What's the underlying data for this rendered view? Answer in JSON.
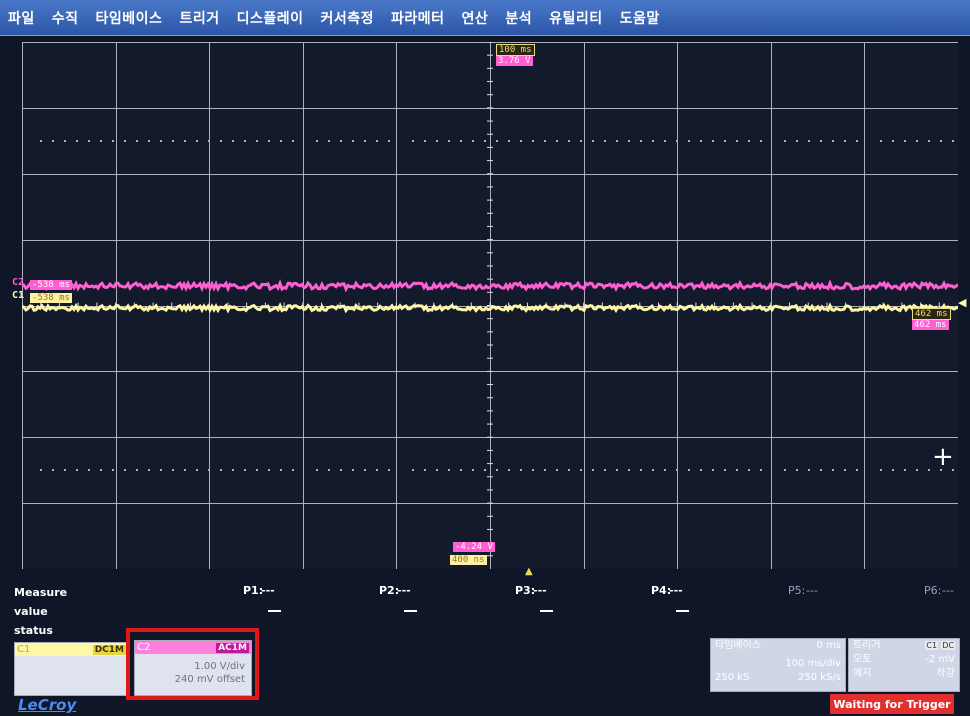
{
  "menu": [
    "파일",
    "수직",
    "타임베이스",
    "트리거",
    "디스플레이",
    "커서측정",
    "파라메터",
    "연산",
    "분석",
    "유틸리티",
    "도움말"
  ],
  "markers": {
    "top_time": "100 ms",
    "top_volt": "3.76 V",
    "bottom_volt": "-4.24 V",
    "bottom_time": "400 ns",
    "left_c2": "-538 ms",
    "left_c1": "-538 ms",
    "right_c1": "462 ms",
    "right_c2": "462 ms",
    "c2_tag": "C2",
    "c1_tag": "C1",
    "trigger_pos_glyph": "▲",
    "level_glyph": "◀",
    "crosshair_glyph": "+"
  },
  "measure": {
    "title": "Measure",
    "value_label": "value",
    "status_label": "status",
    "params": [
      {
        "name": "P1:",
        "value": "---",
        "dash": "—"
      },
      {
        "name": "P2:",
        "value": "---",
        "dash": "—"
      },
      {
        "name": "P3:",
        "value": "---",
        "dash": "—"
      },
      {
        "name": "P4:",
        "value": "---",
        "dash": "—"
      },
      {
        "name": "P5:",
        "value": "---"
      },
      {
        "name": "P6:",
        "value": "---"
      }
    ]
  },
  "channels": {
    "c1": {
      "name": "C1",
      "coupling": "DC1M",
      "color": "#fff7a8"
    },
    "c2": {
      "name": "C2",
      "coupling": "AC1M",
      "vdiv": "1.00 V/div",
      "offset": "240 mV offset",
      "color": "#ff5fd2"
    }
  },
  "timebase": {
    "title": "타임베이스",
    "delay": "0 ms",
    "tdiv": "100 ms/div",
    "samples": "250 kS",
    "rate": "250 kS/s"
  },
  "trigger": {
    "title": "트리거",
    "src": "C1",
    "coupling": "DC",
    "mode": "오토",
    "level": "-2 mV",
    "type": "에지",
    "slope": "하강"
  },
  "brand": "LeCroy",
  "status_text": "Waiting for Trigger",
  "colors": {
    "c1_trace": "#fff7a8",
    "c2_trace": "#ff5fd2",
    "alert": "#e23030"
  }
}
